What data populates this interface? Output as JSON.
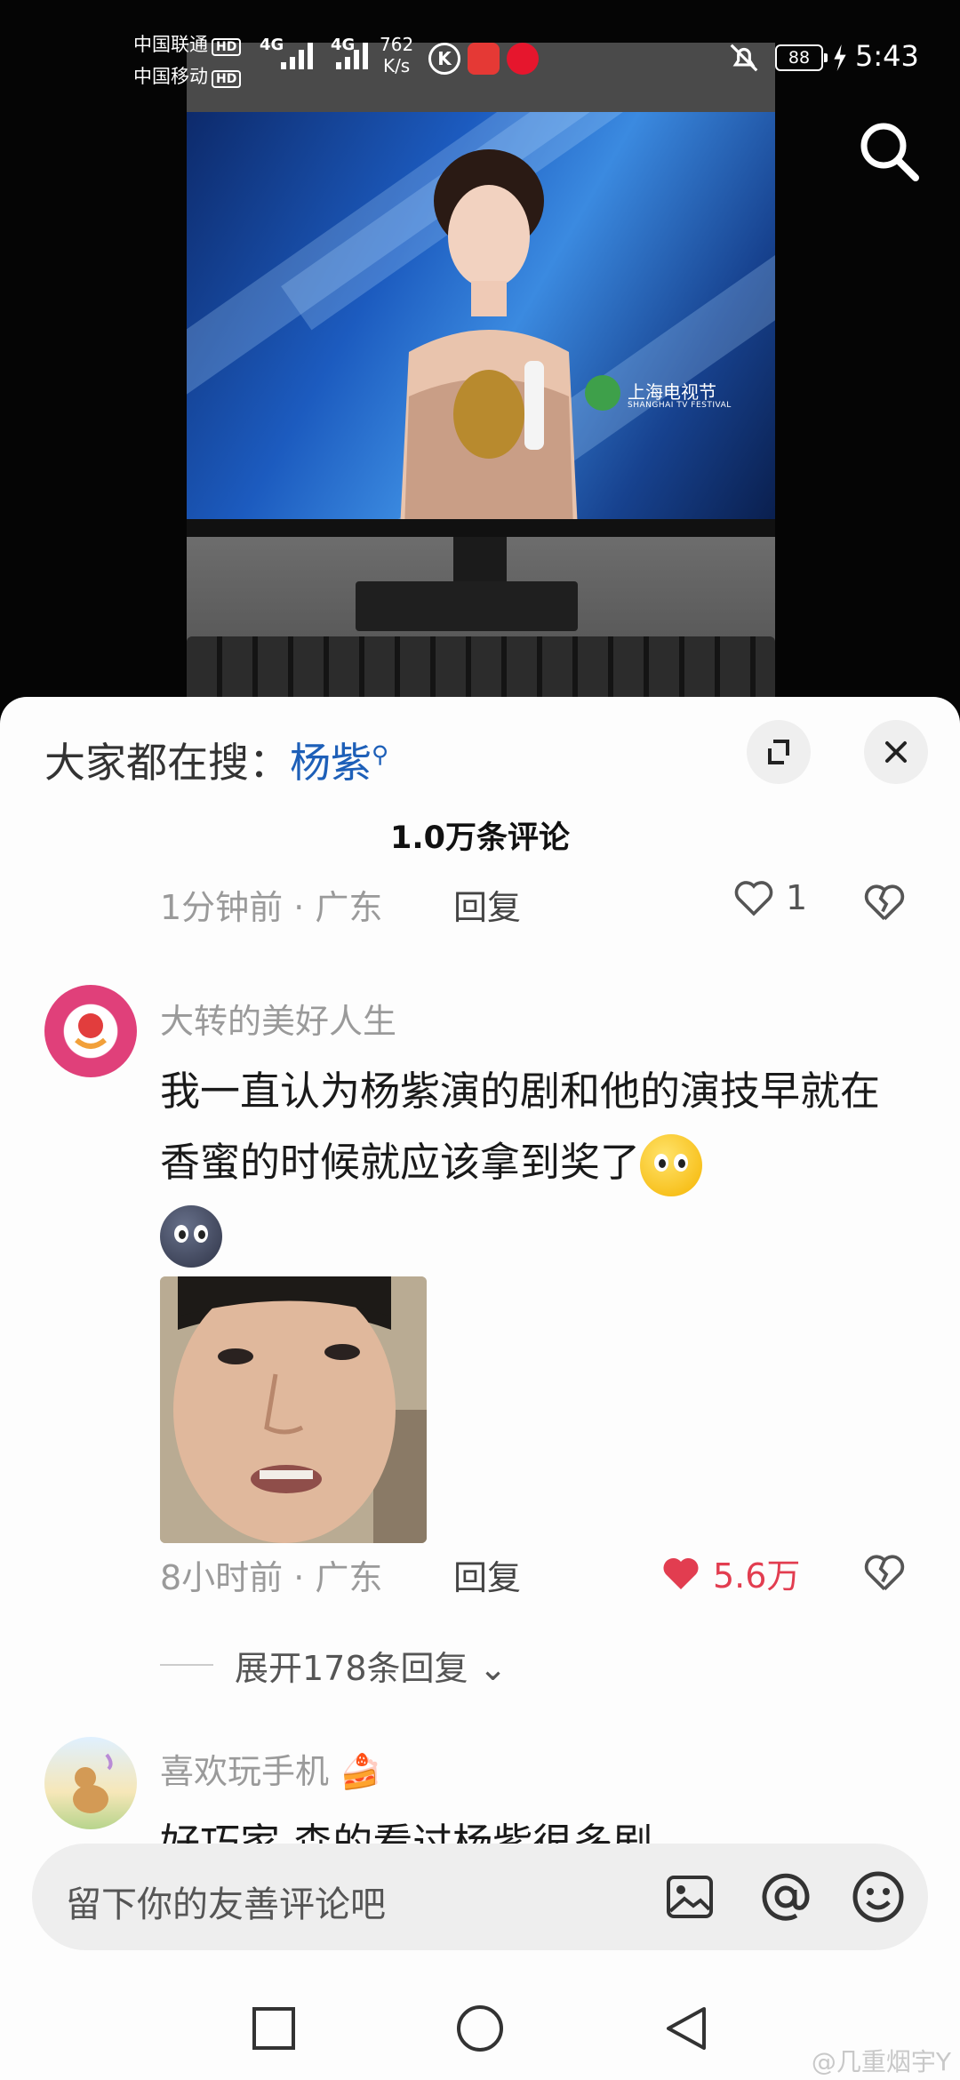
{
  "status_bar": {
    "carrier1": "中国联通",
    "carrier2": "中国移动",
    "hd": "HD",
    "net_type": "4G",
    "net_speed_value": "762",
    "net_speed_unit": "K/s",
    "battery": "88",
    "time": "5:43"
  },
  "video": {
    "tv_logo_cn": "上海电视节",
    "tv_logo_en": "SHANGHAI TV FESTIVAL"
  },
  "sheet": {
    "hot_search_prefix": "大家都在搜：",
    "hot_search_term": "杨紫",
    "comments_count_title": "1.0万条评论",
    "comments": [
      {
        "meta": "1分钟前 · 广东",
        "reply_label": "回复",
        "likes": "1"
      },
      {
        "username": "大转的美好人生",
        "text": "我一直认为杨紫演的剧和他的演技早就在香蜜的时候就应该拿到奖了",
        "emoji1": "flushed-face-emoji",
        "emoji2": "new-moon-face-emoji",
        "meta": "8小时前 · 广东",
        "reply_label": "回复",
        "likes": "5.6万",
        "expand_replies": "展开178条回复"
      },
      {
        "username": "喜欢玩手机",
        "text": "好巧家 森的看过杨紫很多剧"
      }
    ]
  },
  "input": {
    "placeholder": "留下你的友善评论吧"
  },
  "watermark": "@几重烟宇Y",
  "colors": {
    "accent_blue": "#1d5fb8",
    "like_red": "#e23d50"
  }
}
